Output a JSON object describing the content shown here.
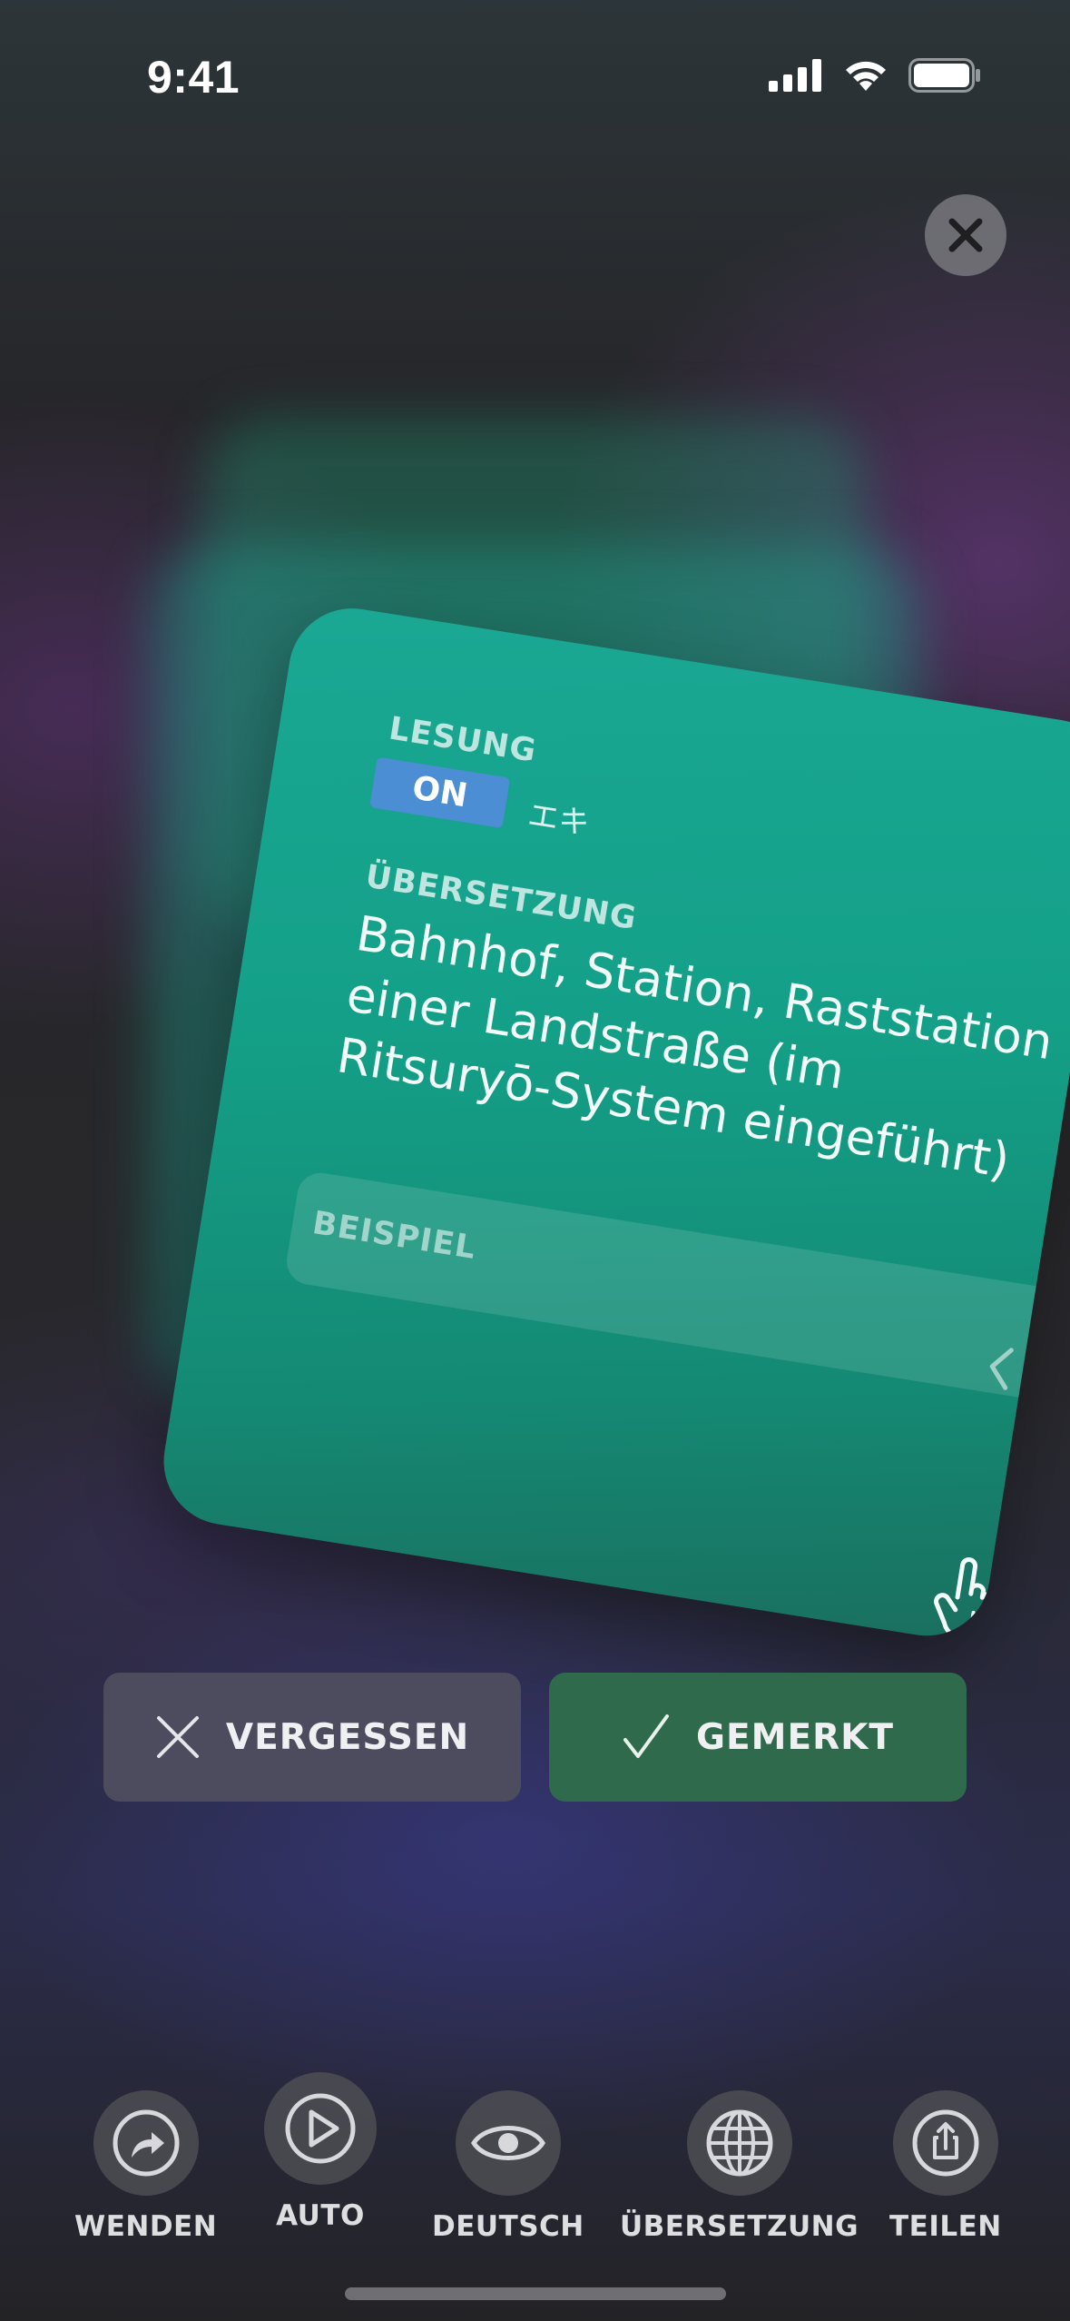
{
  "status_bar": {
    "time": "9:41",
    "icons": [
      "cellular-signal-icon",
      "wifi-icon",
      "battery-icon"
    ]
  },
  "close_icon": "close-icon",
  "card": {
    "reading_label": "LESUNG",
    "reading_badge": "ON",
    "reading_kana": "エキ",
    "translation_label": "ÜBERSETZUNG",
    "translation_text": "Bahnhof, Station, Raststation einer Landstraße (im Ritsuryō-System eingeführt)",
    "example_label": "BEISPIEL",
    "example_expand_icon": "chevron-left-icon",
    "tap_hint_icon": "tap-hand-icon",
    "color": "#14a088"
  },
  "actions": {
    "forgot_label": "VERGESSEN",
    "known_label": "GEMERKT",
    "forgot_color": "#4d4c5e",
    "known_color": "#2f6a4c"
  },
  "toolbar": [
    {
      "label": "WENDEN",
      "icon": "flip-arrow-icon"
    },
    {
      "label": "AUTO",
      "icon": "play-icon"
    },
    {
      "label": "DEUTSCH",
      "icon": "eye-icon"
    },
    {
      "label": "ÜBERSETZUNG",
      "icon": "globe-icon"
    },
    {
      "label": "TEILEN",
      "icon": "share-icon"
    }
  ]
}
